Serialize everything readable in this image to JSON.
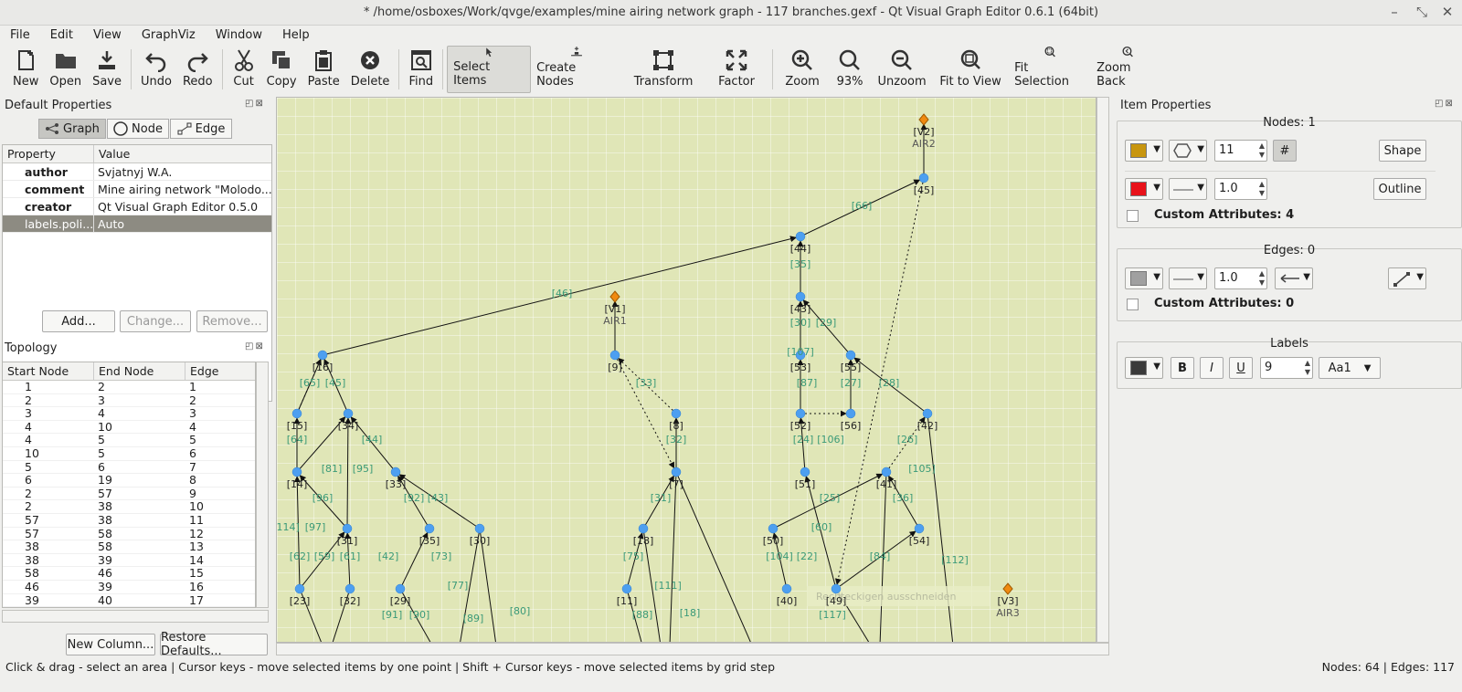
{
  "window": {
    "title": "* /home/osboxes/Work/qvge/examples/mine airing network graph - 117 branches.gexf - Qt Visual Graph Editor 0.6.1 (64bit)"
  },
  "menu": [
    "File",
    "Edit",
    "View",
    "GraphViz",
    "Window",
    "Help"
  ],
  "toolbar": {
    "new": "New",
    "open": "Open",
    "save": "Save",
    "undo": "Undo",
    "redo": "Redo",
    "cut": "Cut",
    "copy": "Copy",
    "paste": "Paste",
    "delete": "Delete",
    "find": "Find",
    "select_items": "Select Items",
    "create_nodes": "Create Nodes",
    "transform": "Transform",
    "factor": "Factor",
    "zoom": "Zoom",
    "zoom_level": "93%",
    "unzoom": "Unzoom",
    "fit_to_view": "Fit to View",
    "fit_selection": "Fit Selection",
    "zoom_back": "Zoom Back"
  },
  "default_properties": {
    "title": "Default Properties",
    "tabs": [
      "Graph",
      "Node",
      "Edge"
    ],
    "columns": [
      "Property",
      "Value"
    ],
    "rows": [
      {
        "property": "author",
        "value": "Svjatnyj W.A."
      },
      {
        "property": "comment",
        "value": "Mine airing network \"Molodo..."
      },
      {
        "property": "creator",
        "value": "Qt Visual Graph Editor 0.5.0"
      },
      {
        "property": "labels.poli...",
        "value": "Auto"
      }
    ],
    "buttons": {
      "add": "Add...",
      "change": "Change...",
      "remove": "Remove..."
    }
  },
  "topology": {
    "title": "Topology",
    "columns": [
      "Start Node",
      "End Node",
      "Edge"
    ],
    "rows": [
      [
        "1",
        "2",
        "1"
      ],
      [
        "2",
        "3",
        "2"
      ],
      [
        "3",
        "4",
        "3"
      ],
      [
        "4",
        "10",
        "4"
      ],
      [
        "4",
        "5",
        "5"
      ],
      [
        "10",
        "5",
        "6"
      ],
      [
        "5",
        "6",
        "7"
      ],
      [
        "6",
        "19",
        "8"
      ],
      [
        "2",
        "57",
        "9"
      ],
      [
        "2",
        "38",
        "10"
      ],
      [
        "57",
        "38",
        "11"
      ],
      [
        "57",
        "58",
        "12"
      ],
      [
        "38",
        "58",
        "13"
      ],
      [
        "38",
        "39",
        "14"
      ],
      [
        "58",
        "46",
        "15"
      ],
      [
        "46",
        "39",
        "16"
      ],
      [
        "39",
        "40",
        "17"
      ]
    ],
    "buttons": {
      "new_column": "New Column...",
      "restore_defaults": "Restore Defaults..."
    }
  },
  "item_properties": {
    "title": "Item Properties",
    "nodes_label": "Nodes: 1",
    "node_size": "11",
    "hash_label": "#",
    "shape_label": "Shape",
    "outline_width": "1.0",
    "outline_label": "Outline",
    "node_custom": "Custom Attributes: 4",
    "edges_label": "Edges: 0",
    "edge_width": "1.0",
    "edge_custom": "Custom Attributes: 0",
    "labels_title": "Labels",
    "bold": "B",
    "italic": "I",
    "underline": "U",
    "font_size": "9",
    "font_label": "Aa1",
    "colors": {
      "node_fill": "#c8960f",
      "node_outline": "#e8121a",
      "edge": "#a0a0a0",
      "label": "#3a3a3a"
    }
  },
  "graph": {
    "nodes": [
      {
        "id": "[V2]",
        "sub": "AIR2",
        "air": true
      },
      {
        "id": "[V1]",
        "sub": "AIR1",
        "air": true
      },
      {
        "id": "[V3]",
        "sub": "AIR3",
        "air": true
      },
      {
        "id": "[45]"
      },
      {
        "id": "[44]"
      },
      {
        "id": "[43]"
      },
      {
        "id": "[16]"
      },
      {
        "id": "[9]"
      },
      {
        "id": "[53]"
      },
      {
        "id": "[55]"
      },
      {
        "id": "[15]"
      },
      {
        "id": "[34]"
      },
      {
        "id": "[8]"
      },
      {
        "id": "[52]"
      },
      {
        "id": "[56]"
      },
      {
        "id": "[42]"
      },
      {
        "id": "[14]"
      },
      {
        "id": "[33]"
      },
      {
        "id": "[7]"
      },
      {
        "id": "[51]"
      },
      {
        "id": "[41]"
      },
      {
        "id": "[31]"
      },
      {
        "id": "[35]"
      },
      {
        "id": "[30]"
      },
      {
        "id": "[18]"
      },
      {
        "id": "[50]"
      },
      {
        "id": "[54]"
      },
      {
        "id": "[23]"
      },
      {
        "id": "[32]"
      },
      {
        "id": "[29]"
      },
      {
        "id": "[11]"
      },
      {
        "id": "[40]"
      },
      {
        "id": "[49]"
      }
    ],
    "edge_labels": [
      "[66]",
      "[35]",
      "[46]",
      "[30]",
      "[29]",
      "[33]",
      "[107]",
      "[65]",
      "[45]",
      "[87]",
      "[27]",
      "[28]",
      "[32]",
      "[24]",
      "[106]",
      "[26]",
      "[64]",
      "[44]",
      "[81]",
      "[95]",
      "[105]",
      "[96]",
      "[92]",
      "[43]",
      "[31]",
      "[25]",
      "[36]",
      "[114]",
      "[97]",
      "[60]",
      "[62]",
      "[59]",
      "[61]",
      "[42]",
      "[73]",
      "[75]",
      "[104]",
      "[22]",
      "[84]",
      "[112]",
      "[77]",
      "[111]",
      "[80]",
      "[91]",
      "[90]",
      "[89]",
      "[88]",
      "[18]",
      "[117]"
    ],
    "tooltip": "Rechteckigen ausschneiden"
  },
  "status": {
    "hint": "Click & drag - select an area | Cursor keys - move selected items by one point | Shift + Cursor keys - move selected items by grid step",
    "counts": "Nodes: 64 | Edges: 117"
  }
}
